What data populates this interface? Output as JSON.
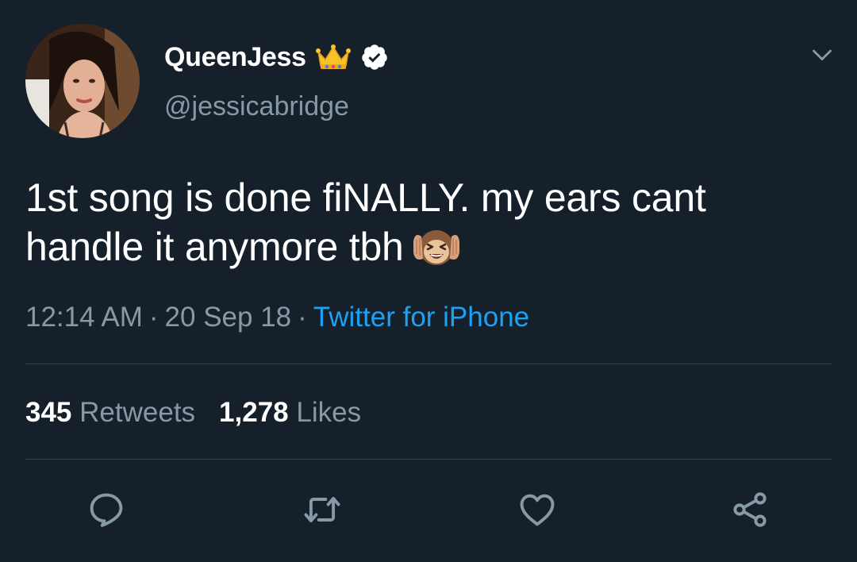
{
  "user": {
    "display_name": "QueenJess",
    "handle": "@jessicabridge",
    "badges": [
      "crown-emoji",
      "verified-icon"
    ]
  },
  "tweet": {
    "text": "1st song is done fiNALLY. my ears cant handle it anymore tbh",
    "emoji": "hear-no-evil-monkey-emoji"
  },
  "meta": {
    "time": "12:14 AM",
    "separator": "·",
    "date": "20 Sep 18",
    "source": "Twitter for iPhone"
  },
  "stats": {
    "retweets_count": "345",
    "retweets_label": "Retweets",
    "likes_count": "1,278",
    "likes_label": "Likes"
  },
  "actions": [
    "reply-icon",
    "retweet-icon",
    "like-icon",
    "share-icon"
  ],
  "colors": {
    "background": "#15202b",
    "text": "#ffffff",
    "secondary": "#8899a6",
    "link": "#1da1f2",
    "divider": "#38444d"
  }
}
